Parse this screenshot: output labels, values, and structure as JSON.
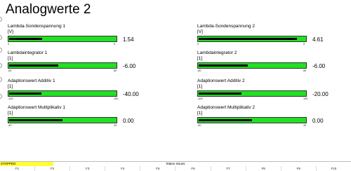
{
  "title": "Analogwerte 2",
  "gauges_left": [
    {
      "label": "Lambda-Sondenspannung 1",
      "unit": "[V]",
      "min": "0",
      "max": "5",
      "value": "1.54",
      "fill_fraction": 0.308
    },
    {
      "label": "Lambdaintegrator 1",
      "unit": "[1]",
      "min": "-80",
      "max": "80",
      "value": "-6.00",
      "fill_fraction": 0.46
    },
    {
      "label": "Adaptionswert Additiv 1",
      "unit": "[1]",
      "min": "-100",
      "max": "100",
      "value": "-40.00",
      "fill_fraction": 0.3
    },
    {
      "label": "Adaptionswert Multiplikativ 1",
      "unit": "[1]",
      "min": "-40",
      "max": "40",
      "value": "0.00",
      "fill_fraction": 0.5
    }
  ],
  "gauges_right": [
    {
      "label": "Lambda-Sondenspannung 2",
      "unit": "[V]",
      "min": "0",
      "max": "5",
      "value": "4.61",
      "fill_fraction": 0.92
    },
    {
      "label": "Lambdaintegrator 2",
      "unit": "[1]",
      "min": "-80",
      "max": "80",
      "value": "-6.00",
      "fill_fraction": 0.46
    },
    {
      "label": "Adaptionswert Additiv 2",
      "unit": "[1]",
      "min": "-100",
      "max": "100",
      "value": "-20.00",
      "fill_fraction": 0.4
    },
    {
      "label": "Adaptionswert Multiplikativ 2",
      "unit": "[1]",
      "min": "-40",
      "max": "40",
      "value": "0.00",
      "fill_fraction": 0.5
    }
  ],
  "status": {
    "state": "STOPPED",
    "issues": "Status Issues",
    "state_color": "#ffff33"
  },
  "function_keys": [
    "F1",
    "F2",
    "F3",
    "F4",
    "F5",
    "F6",
    "F7",
    "F8",
    "F9",
    "F10"
  ],
  "colors": {
    "bar_background": "#22e022",
    "bar_fill": "#000000"
  }
}
